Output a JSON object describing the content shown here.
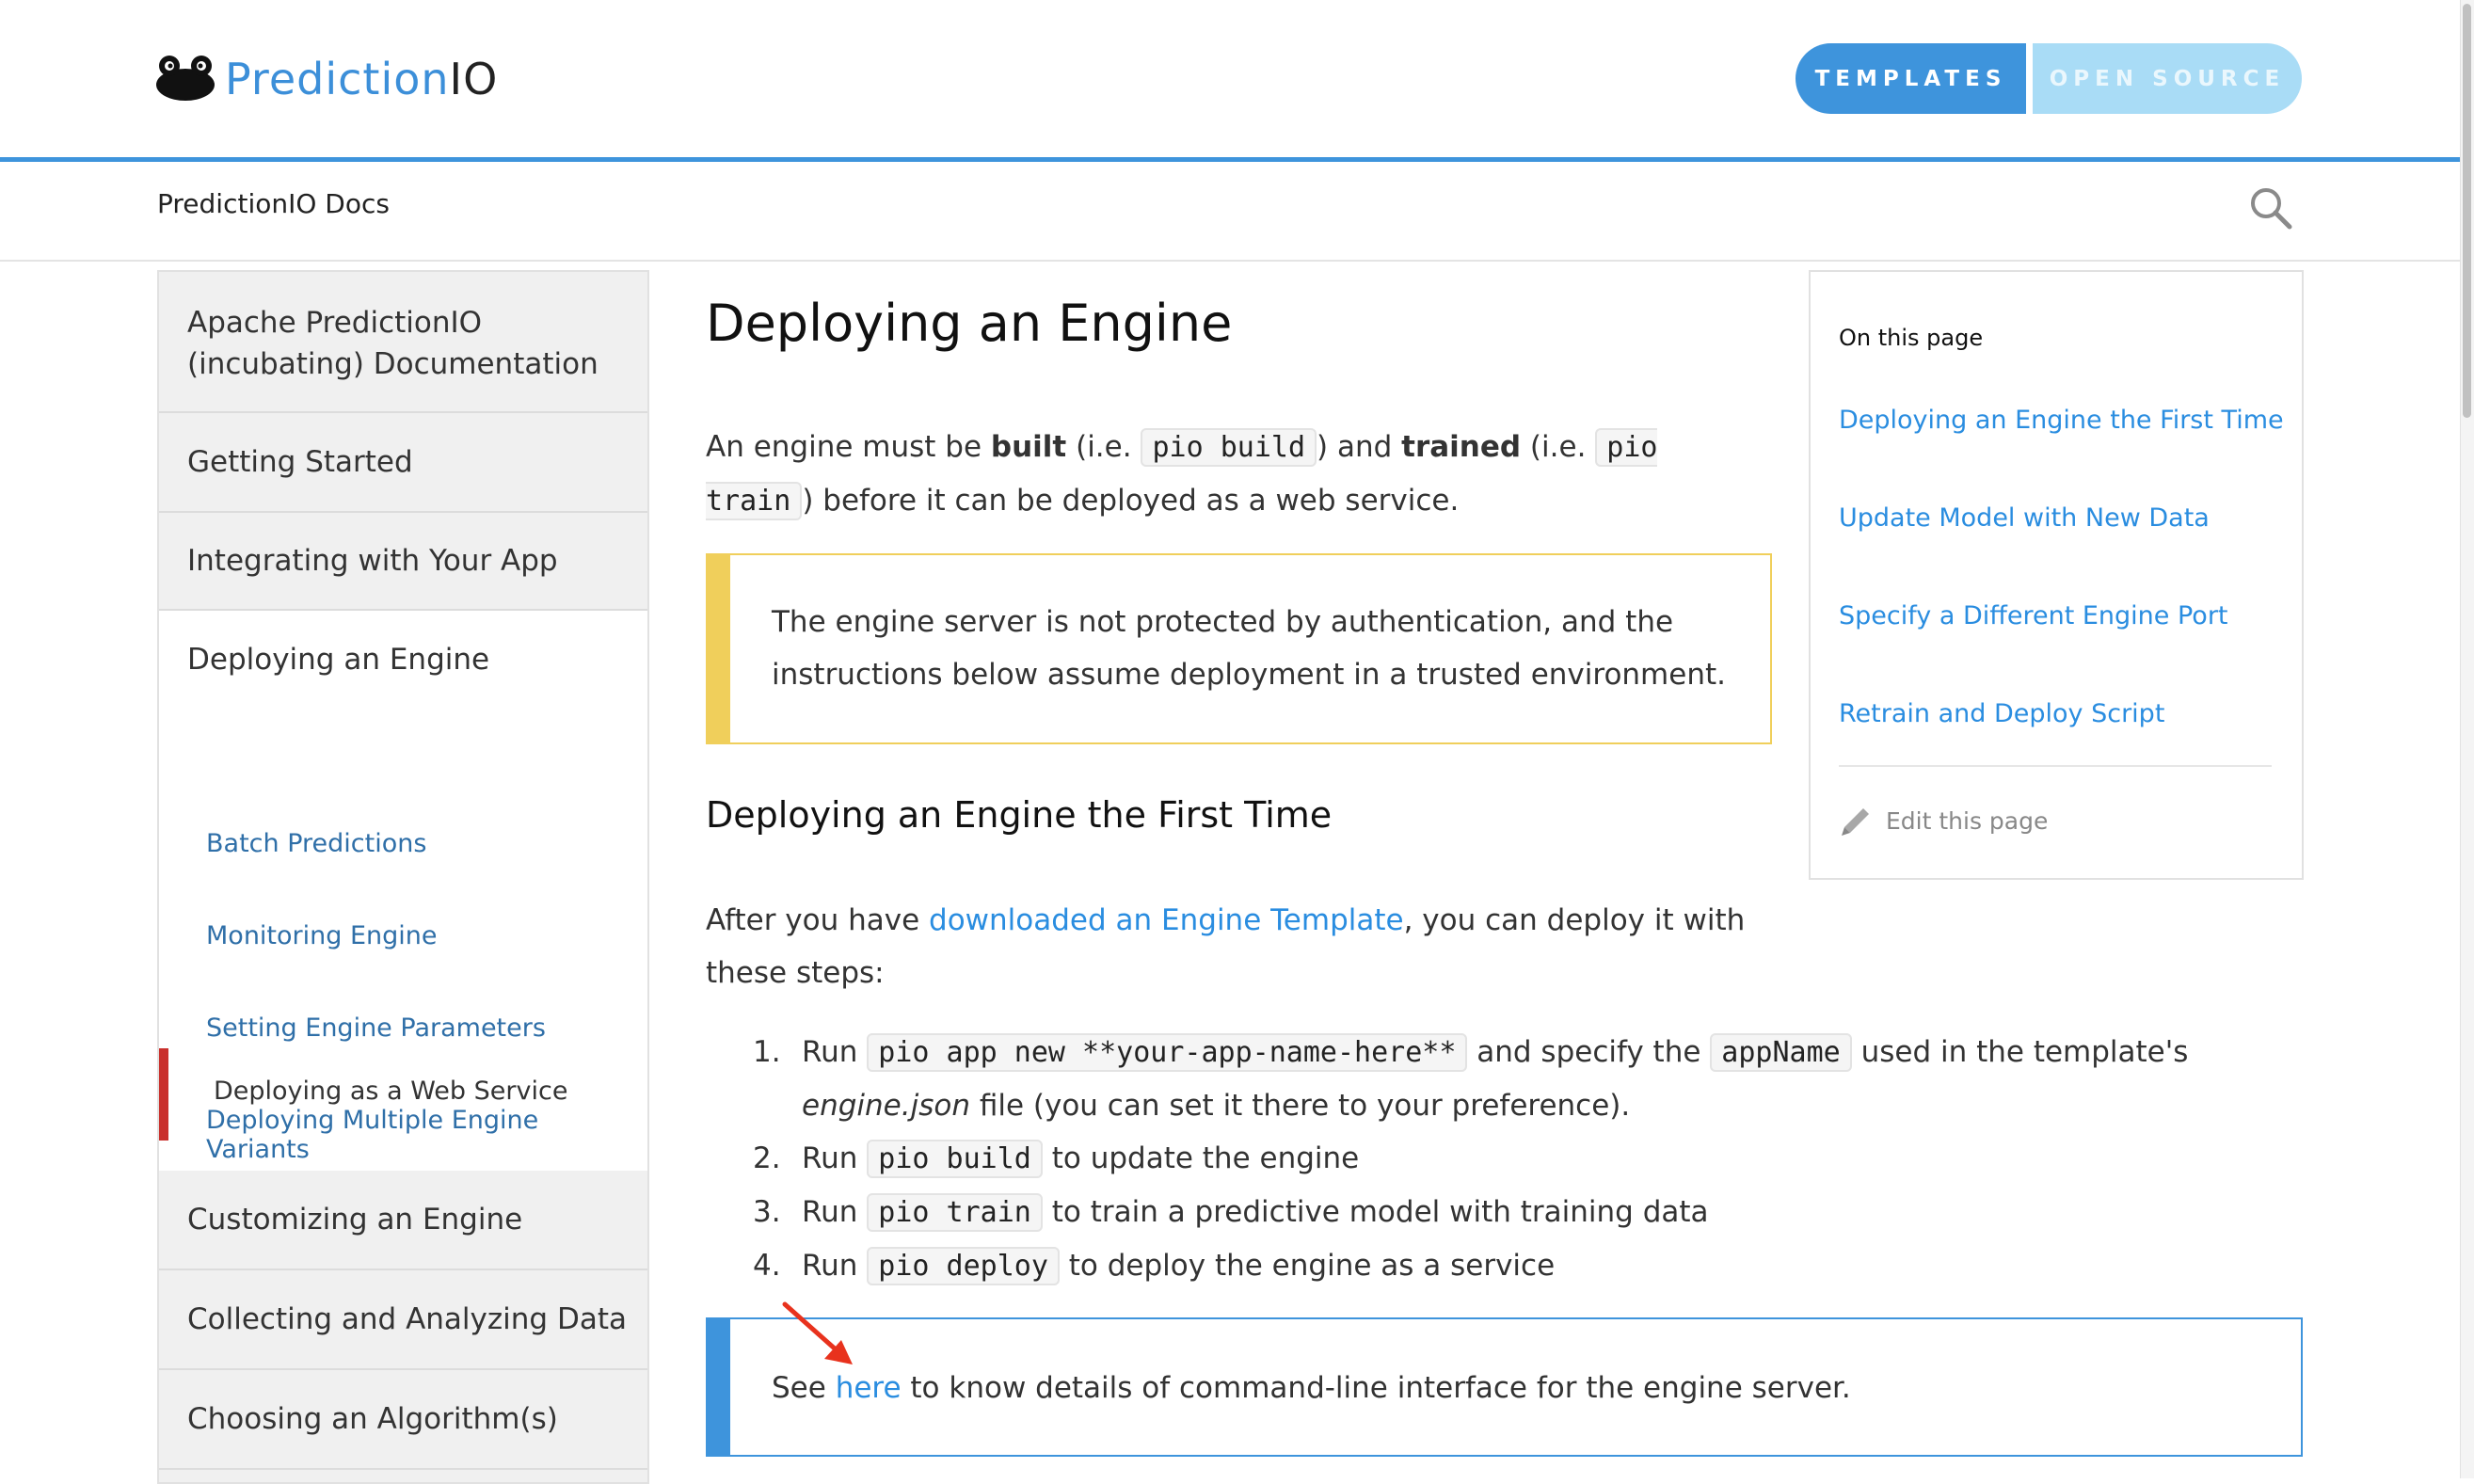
{
  "header": {
    "brand_part1": "Prediction",
    "brand_part2": "IO",
    "templates_label": "TEMPLATES",
    "open_source_label": "OPEN SOURCE"
  },
  "subheader": {
    "title": "PredictionIO Docs"
  },
  "sidebar": {
    "items": [
      "Apache PredictionIO (incubating) Documentation",
      "Getting Started",
      "Integrating with Your App",
      "Deploying an Engine",
      "Customizing an Engine",
      "Collecting and Analyzing Data",
      "Choosing an Algorithm(s)"
    ],
    "sub_items": [
      "Deploying as a Web Service",
      "Batch Predictions",
      "Monitoring Engine",
      "Setting Engine Parameters",
      "Deploying Multiple Engine Variants"
    ]
  },
  "content": {
    "title": "Deploying an Engine",
    "intro": {
      "t1": "An engine must be ",
      "built": "built",
      "t2": " (i.e. ",
      "code_build": "pio build",
      "t3": ") and ",
      "trained": "trained",
      "t4": " (i.e. ",
      "code_train": "pio train",
      "t5": ") before it can be deployed as a web service."
    },
    "warning": "The engine server is not protected by authentication, and the instructions below assume deployment in a trusted environment.",
    "section_title": "Deploying an Engine the First Time",
    "after": {
      "t1": "After you have ",
      "link": "downloaded an Engine Template",
      "t2": ", you can deploy it with these steps:"
    },
    "steps": {
      "s1": {
        "num": "1.",
        "run": "Run ",
        "code": "pio app new **your-app-name-here**",
        "mid": " and specify the ",
        "code2": "appName",
        "tail": " used in the template's ",
        "em": "engine.json",
        "end": " file (you can set it there to your preference)."
      },
      "s2": {
        "num": "2.",
        "run": "Run ",
        "code": "pio build",
        "tail": " to update the engine"
      },
      "s3": {
        "num": "3.",
        "run": "Run ",
        "code": "pio train",
        "tail": " to train a predictive model with training data"
      },
      "s4": {
        "num": "4.",
        "run": "Run ",
        "code": "pio deploy",
        "tail": " to deploy the engine as a service"
      }
    },
    "info": {
      "t1": "See ",
      "link": "here",
      "t2": " to know details of command-line interface for the engine server."
    }
  },
  "toc": {
    "title": "On this page",
    "links": [
      "Deploying an Engine the First Time",
      "Update Model with New Data",
      "Specify a Different Engine Port",
      "Retrain and Deploy Script"
    ],
    "edit_label": "Edit this page"
  },
  "colors": {
    "accent": "#3e94dc",
    "link": "#2a8de0",
    "warning": "#f0cf5b",
    "active_marker": "#c9302c",
    "annotation_arrow": "#e8321d"
  },
  "icons": [
    "logo-frog-icon",
    "search-icon",
    "pencil-icon",
    "red-arrow-icon"
  ]
}
